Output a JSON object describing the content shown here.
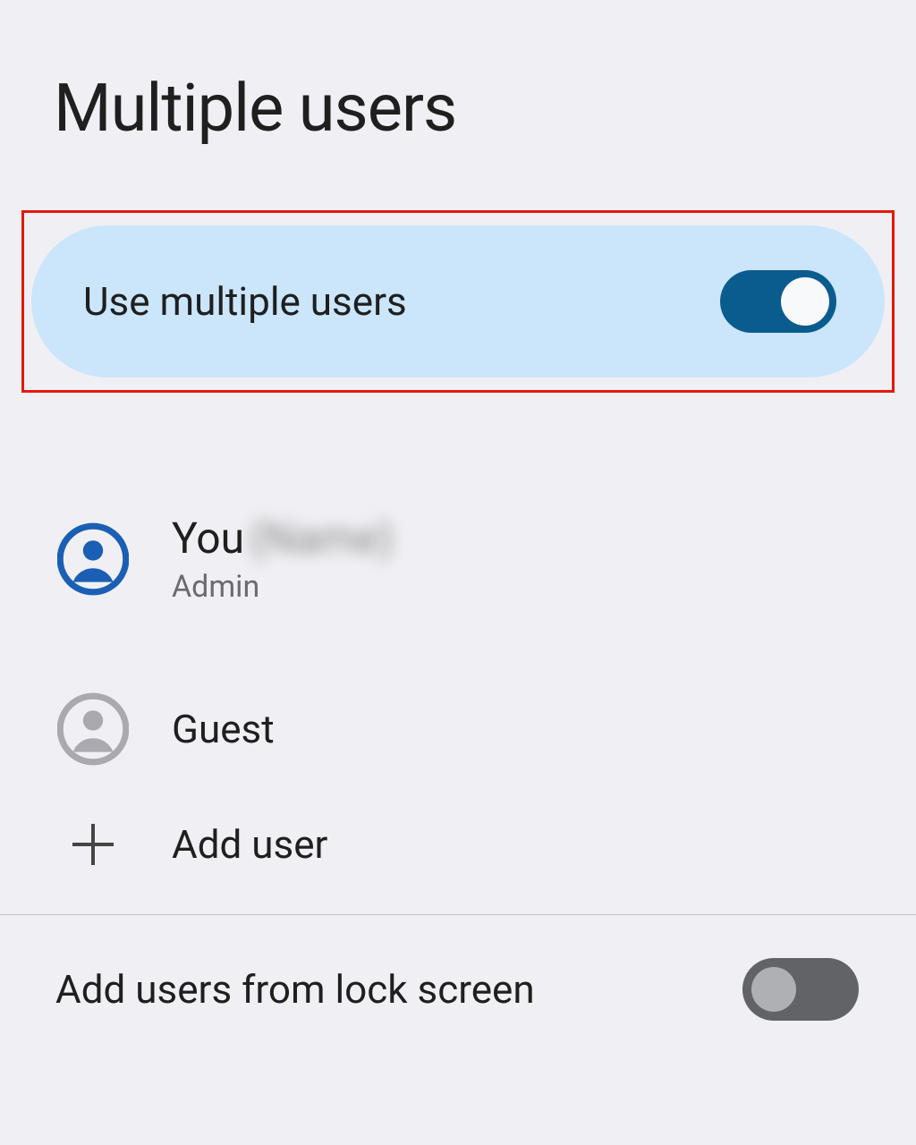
{
  "title": "Multiple users",
  "main_toggle": {
    "label": "Use multiple users",
    "state": "on"
  },
  "users": [
    {
      "name": "You",
      "name_redacted": "(Name)",
      "role": "Admin",
      "avatar": "admin"
    },
    {
      "name": "Guest",
      "avatar": "guest"
    }
  ],
  "add_user_label": "Add user",
  "lock_screen": {
    "label": "Add users from lock screen",
    "state": "off"
  }
}
